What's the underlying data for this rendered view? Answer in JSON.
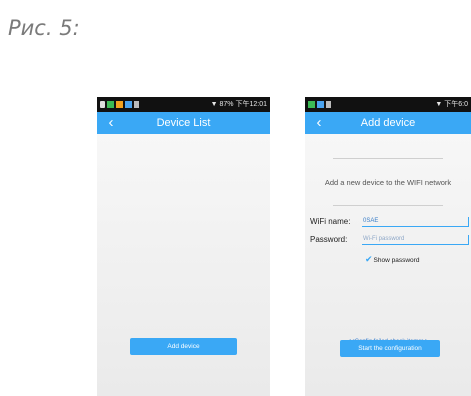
{
  "caption": "Рис. 5:",
  "screen1": {
    "status_right": "87% 下午12:01",
    "title": "Device List",
    "add_device_button": "Add device"
  },
  "screen2": {
    "status_right": "下午6:0",
    "title": "Add device",
    "instruction": "Add a new device to the WIFI network",
    "wifi_name_label": "WiFi name:",
    "wifi_name_value": "0SAE",
    "password_label": "Password:",
    "password_placeholder": "Wi-Fi password",
    "show_password_label": "Show password",
    "config_failed_link": "<<Config failed check items>>",
    "start_button": "Start the configuration"
  },
  "colors": {
    "accent": "#3aa8f5",
    "statusbar": "#111111"
  }
}
